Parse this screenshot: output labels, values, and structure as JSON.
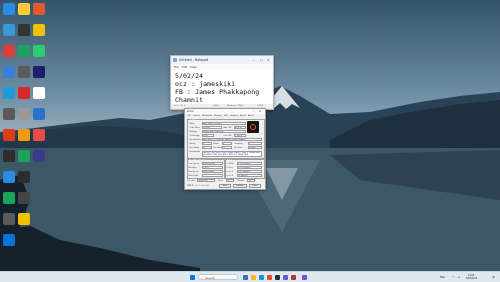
{
  "notepad": {
    "title": "Untitled - Notepad",
    "menu": [
      "File",
      "Edit",
      "View"
    ],
    "lines": [
      "5/02/24",
      "ocz : jameskiki",
      "FB : James Phakkapong",
      "Chamnit"
    ],
    "status": {
      "position": "Ln 1, Col 1",
      "zoom": "100%",
      "line_ending": "Windows (CRLF)",
      "encoding": "UTF-8"
    }
  },
  "cpuz": {
    "title": "CPU-Z",
    "tabs": [
      "CPU",
      "Caches",
      "Mainboard",
      "Memory",
      "SPD",
      "Graphics",
      "Bench",
      "About"
    ],
    "processor": {
      "section": "Processor",
      "name_label": "Name",
      "name_value": "AMD Ryzen 7 8700G",
      "codename_label": "Code Name",
      "codename_value": "Phoenix",
      "tdp_label": "Max TDP",
      "tdp_value": "65.0 W",
      "package_label": "Package",
      "package_value": "Socket AM5 (LGA1718)",
      "tech_label": "Technology",
      "tech_value": "4 nm",
      "voltage_label": "Core VID",
      "voltage_value": "1.250 V",
      "spec_label": "Specification",
      "spec_value": "AMD Ryzen 7 8700G w/ Radeon 780M Graphics",
      "family_label": "Family",
      "family_value": "F",
      "model_label": "Model",
      "model_value": "5",
      "stepping_label": "Stepping",
      "stepping_value": "2",
      "extfamily_label": "Ext. Family",
      "extfamily_value": "19",
      "extmodel_label": "Ext. Model",
      "extmodel_value": "75",
      "revision_label": "Revision",
      "revision_value": "PHX-A2",
      "instructions_label": "Instructions",
      "instructions_value": "MMX(+), SSE, SSE2, SSE3, SSSE3, SSE4.1, SSE4.2, SSE4A, x86-64, AMD-V, AES, AVX, AVX2, AVX512F, FMA3, SHA"
    },
    "clocks": {
      "section": "Clocks (Core #0)",
      "core_speed_label": "Core Speed",
      "core_speed_value": "4200.00 MHz",
      "multiplier_label": "Multiplier",
      "multiplier_value": "x 42.0",
      "bus_speed_label": "Bus Speed",
      "bus_speed_value": "100.00 MHz",
      "fsb_label": "Rated FSB",
      "fsb_value": ""
    },
    "caches": {
      "section": "Cache",
      "l1d_label": "L1 Data",
      "l1d_value": "8 x 32 KBytes",
      "l1i_label": "L1 Inst.",
      "l1i_value": "8 x 32 KBytes",
      "l2_label": "Level 2",
      "l2_value": "8 x 1 MBytes",
      "l3_label": "Level 3",
      "l3_value": "16 MBytes"
    },
    "selection_label": "Selection",
    "selection_value": "Socket #1",
    "cores_label": "Cores",
    "cores_value": "8",
    "threads_label": "Threads",
    "threads_value": "16",
    "footer_brand": "CPU-Z",
    "footer_version": "Ver. 2.09.0.x64",
    "tools_label": "Tools",
    "validate_label": "Validate",
    "close_label": "Close"
  },
  "taskbar": {
    "search_placeholder": "Search",
    "language": "ENG",
    "time": "12:00",
    "date": "5/02/2024"
  },
  "colors": {
    "sky_top": "#3c5a72",
    "sky_mid": "#7f9bb0",
    "lake": "#3d5868",
    "mountain": "#24384a",
    "taskbar": "#dfe7ef"
  }
}
